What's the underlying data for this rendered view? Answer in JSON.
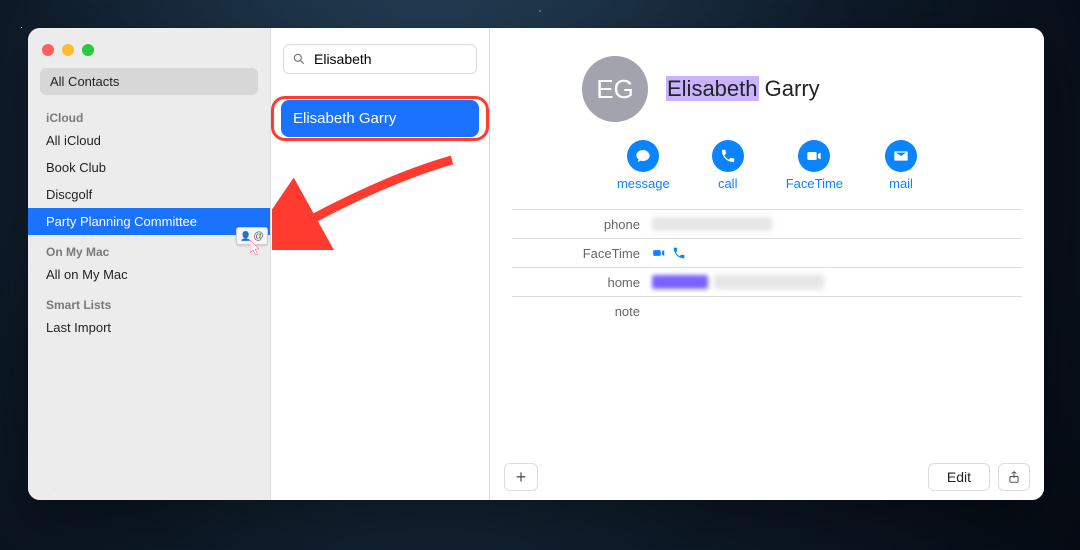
{
  "sidebar": {
    "all_contacts": "All Contacts",
    "sections": [
      {
        "header": "iCloud",
        "items": [
          {
            "label": "All iCloud",
            "selected": false
          },
          {
            "label": "Book Club",
            "selected": false
          },
          {
            "label": "Discgolf",
            "selected": false
          },
          {
            "label": "Party Planning Committee",
            "selected": true
          }
        ]
      },
      {
        "header": "On My Mac",
        "items": [
          {
            "label": "All on My Mac",
            "selected": false
          }
        ]
      },
      {
        "header": "Smart Lists",
        "items": [
          {
            "label": "Last Import",
            "selected": false
          }
        ]
      }
    ]
  },
  "search": {
    "query": "Elisabeth",
    "placeholder": "Search",
    "results": [
      {
        "label": "Elisabeth Garry",
        "selected": true,
        "highlighted": true
      }
    ]
  },
  "contact": {
    "initials": "EG",
    "first": "Elisabeth",
    "last": "Garry",
    "actions": {
      "message": "message",
      "call": "call",
      "facetime": "FaceTime",
      "mail": "mail"
    },
    "fields": {
      "phone_label": "phone",
      "phone_value_redacted": true,
      "facetime_label": "FaceTime",
      "home_label": "home",
      "home_value_redacted": true,
      "note_label": "note"
    }
  },
  "footer": {
    "add_label": "+",
    "edit_label": "Edit"
  },
  "drag": {
    "badge_person_icon": "person-card-icon",
    "badge_at": "@"
  },
  "colors": {
    "selected_blue": "#1a73ff",
    "action_blue": "#0a84ff",
    "highlight_red": "#ff3b30"
  }
}
